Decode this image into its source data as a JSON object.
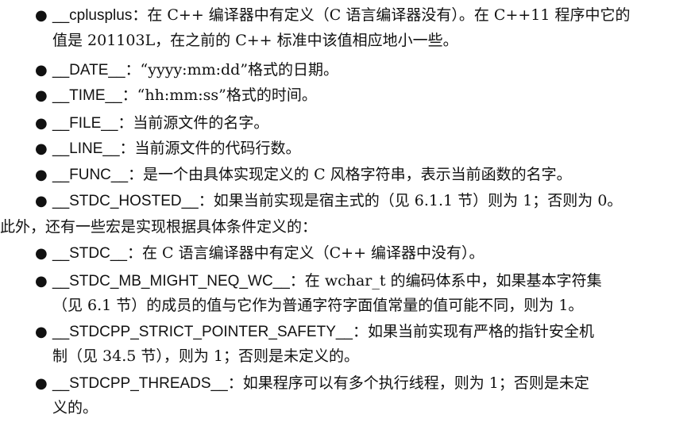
{
  "bullet_symbol": "●",
  "items_a": [
    {
      "code": "__cplusplus",
      "line1": "：在 C++ 编译器中有定义（C 语言编译器没有）。在 C++11 程序中它的",
      "line2": "值是 201103L，在之前的 C++ 标准中该值相应地小一些。"
    },
    {
      "code": "__DATE__",
      "line1": "：“yyyy:mm:dd”格式的日期。"
    },
    {
      "code": "__TIME__",
      "line1": "：“hh:mm:ss”格式的时间。"
    },
    {
      "code": "__FILE__",
      "line1": "：当前源文件的名字。"
    },
    {
      "code": "__LINE__",
      "line1": "：当前源文件的代码行数。"
    },
    {
      "code": "__FUNC__",
      "line1": "：是一个由具体实现定义的 C 风格字符串，表示当前函数的名字。"
    },
    {
      "code": "__STDC_HOSTED__",
      "line1": "：如果当前实现是宿主式的（见 6.1.1 节）则为 1；否则为 0。"
    }
  ],
  "intro": "此外，还有一些宏是实现根据具体条件定义的：",
  "items_b": [
    {
      "code": "__STDC__",
      "line1": "：在 C 语言编译器中有定义（C++ 编译器中没有）。"
    },
    {
      "code": "__STDC_MB_MIGHT_NEQ_WC__",
      "line1": "：在 wchar_t 的编码体系中，如果基本字符集",
      "line2": "（见 6.1 节）的成员的值与它作为普通字符字面值常量的值可能不同，则为 1。"
    },
    {
      "code": "__STDCPP_STRICT_POINTER_SAFETY__",
      "line1": "：如果当前实现有严格的指针安全机",
      "line2": "制（见 34.5 节），则为 1；否则是未定义的。"
    },
    {
      "code": "__STDCPP_THREADS__",
      "line1": "：如果程序可以有多个执行线程，则为 1；否则是未定",
      "line2": "义的。"
    }
  ]
}
